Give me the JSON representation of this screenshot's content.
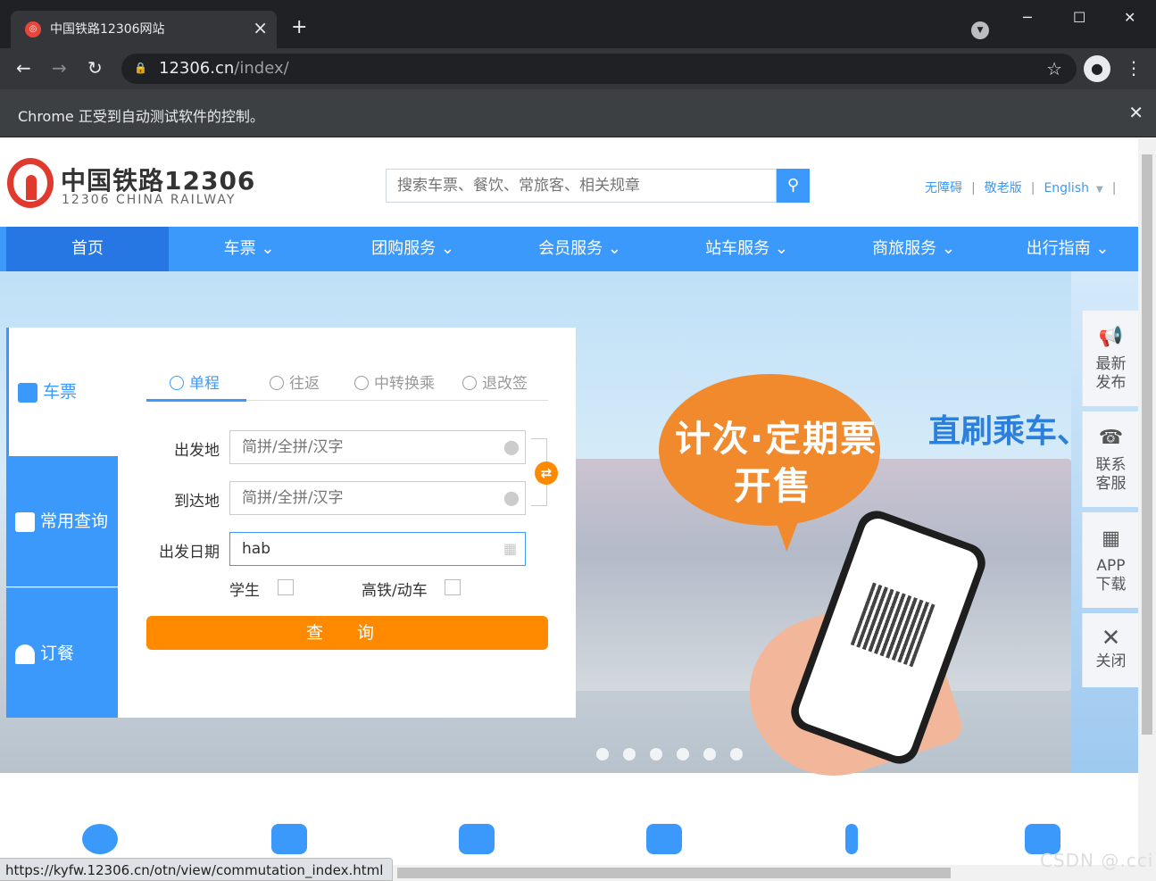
{
  "browser": {
    "tab_title": "中国铁路12306网站",
    "tab_favicon": "12306-logo-icon",
    "url_host": "12306.cn",
    "url_path": "/index/",
    "automation_banner": "Chrome 正受到自动测试软件的控制。",
    "status_url": "https://kyfw.12306.cn/otn/view/commutation_index.html",
    "new_tab_glyph": "+",
    "close_glyph": "×"
  },
  "site": {
    "logo_cn": "中国铁路12306",
    "logo_en": "12306 CHINA RAILWAY",
    "search_placeholder": "搜索车票、餐饮、常旅客、相关规章",
    "top_links": [
      "无障碍",
      "敬老版",
      "English"
    ],
    "nav": [
      "首页",
      "车票",
      "团购服务",
      "会员服务",
      "站车服务",
      "商旅服务",
      "出行指南"
    ],
    "brand_color": "#3b99fc",
    "accent_color": "#ff8a00"
  },
  "banner": {
    "bubble_line1": "计次·定期票",
    "bubble_line2": "开售",
    "slogan": "直刷乘车、"
  },
  "query": {
    "side_items": [
      "车票",
      "常用查询",
      "订餐"
    ],
    "tabs": [
      "单程",
      "往返",
      "中转换乘",
      "退改签"
    ],
    "from_label": "出发地",
    "to_label": "到达地",
    "date_label": "出发日期",
    "from_placeholder": "简拼/全拼/汉字",
    "to_placeholder": "简拼/全拼/汉字",
    "date_value": "hab",
    "student_label": "学生",
    "highspeed_label": "高铁/动车",
    "search_button": "查 询"
  },
  "right_sidebar": {
    "news": "最新发布",
    "contact": "联系客服",
    "app": "APP下载",
    "close": "关闭"
  },
  "watermark": "CSDN @.cci"
}
